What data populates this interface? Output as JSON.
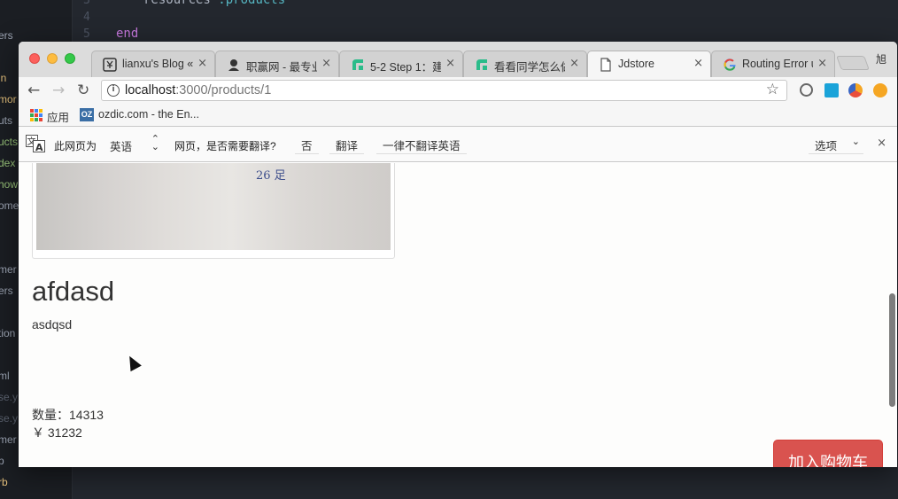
{
  "editor": {
    "line_numbers": [
      "3",
      "4",
      "5"
    ],
    "code_line_1": "resources",
    "code_line_1_sym": ":products",
    "code_line_2": "end",
    "sidebar_items": [
      "ers",
      "in",
      "mor",
      "uts",
      "ucts",
      "dex",
      "how",
      "ome",
      "mer",
      "ers",
      "tion",
      "ml",
      "se.y",
      "se.y",
      "mer",
      "p",
      "rb"
    ]
  },
  "browser": {
    "tabs": [
      {
        "title": "lianxu's Blog «",
        "icon": "blog-favicon-icon"
      },
      {
        "title": "职赢网 - 最专业",
        "icon": "zhiying-favicon-icon"
      },
      {
        "title": "5-2 Step 1：建",
        "icon": "step-favicon-icon"
      },
      {
        "title": "看看同学怎么做",
        "icon": "step-favicon-icon"
      },
      {
        "title": "Jdstore",
        "icon": "page-icon"
      },
      {
        "title": "Routing Error u",
        "icon": "google-icon"
      }
    ],
    "close_glyph": "×",
    "profile": "旭",
    "url_host": "localhost",
    "url_path": ":3000/products/1",
    "bookmarks": {
      "apps": "应用",
      "site": "ozdic.com - the En..."
    },
    "translate": {
      "prefix": "此网页为",
      "language": "英语",
      "question": "网页，是否需要翻译?",
      "no": "否",
      "translate": "翻译",
      "never": "一律不翻译英语",
      "options": "选项"
    }
  },
  "product": {
    "image_text": "26 足",
    "title": "afdasd",
    "description": "asdqsd",
    "quantity": "数量：14313",
    "price": "￥ 31232",
    "add_to_cart": "加入购物车"
  },
  "colors": {
    "accent": "#d9534f",
    "chrome": "#dcdcdc"
  }
}
